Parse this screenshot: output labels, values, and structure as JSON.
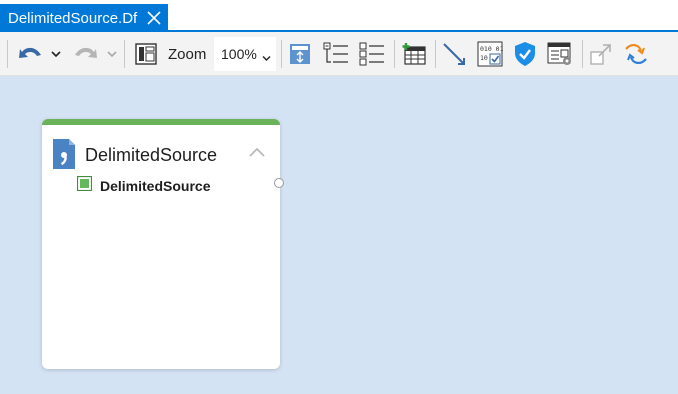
{
  "tab": {
    "title": "DelimitedSource.Df"
  },
  "toolbar": {
    "zoom_label": "Zoom",
    "zoom_value": "100%",
    "buttons": [
      "undo-icon",
      "undo-dropdown-icon",
      "redo-icon",
      "redo-dropdown-icon",
      "layout-view-icon",
      "fit-page-icon",
      "collapse-all-icon",
      "expand-all-icon",
      "add-table-icon",
      "connector-icon",
      "data-preview-icon",
      "validate-shield-icon",
      "properties-icon",
      "restore-icon",
      "refresh-icon"
    ],
    "accent_color": "#0078d7"
  },
  "canvas": {
    "background": "#d4e3f4",
    "card": {
      "title": "DelimitedSource",
      "header_color": "#6ab35b",
      "fields": [
        {
          "label": "DelimitedSource"
        }
      ]
    }
  }
}
